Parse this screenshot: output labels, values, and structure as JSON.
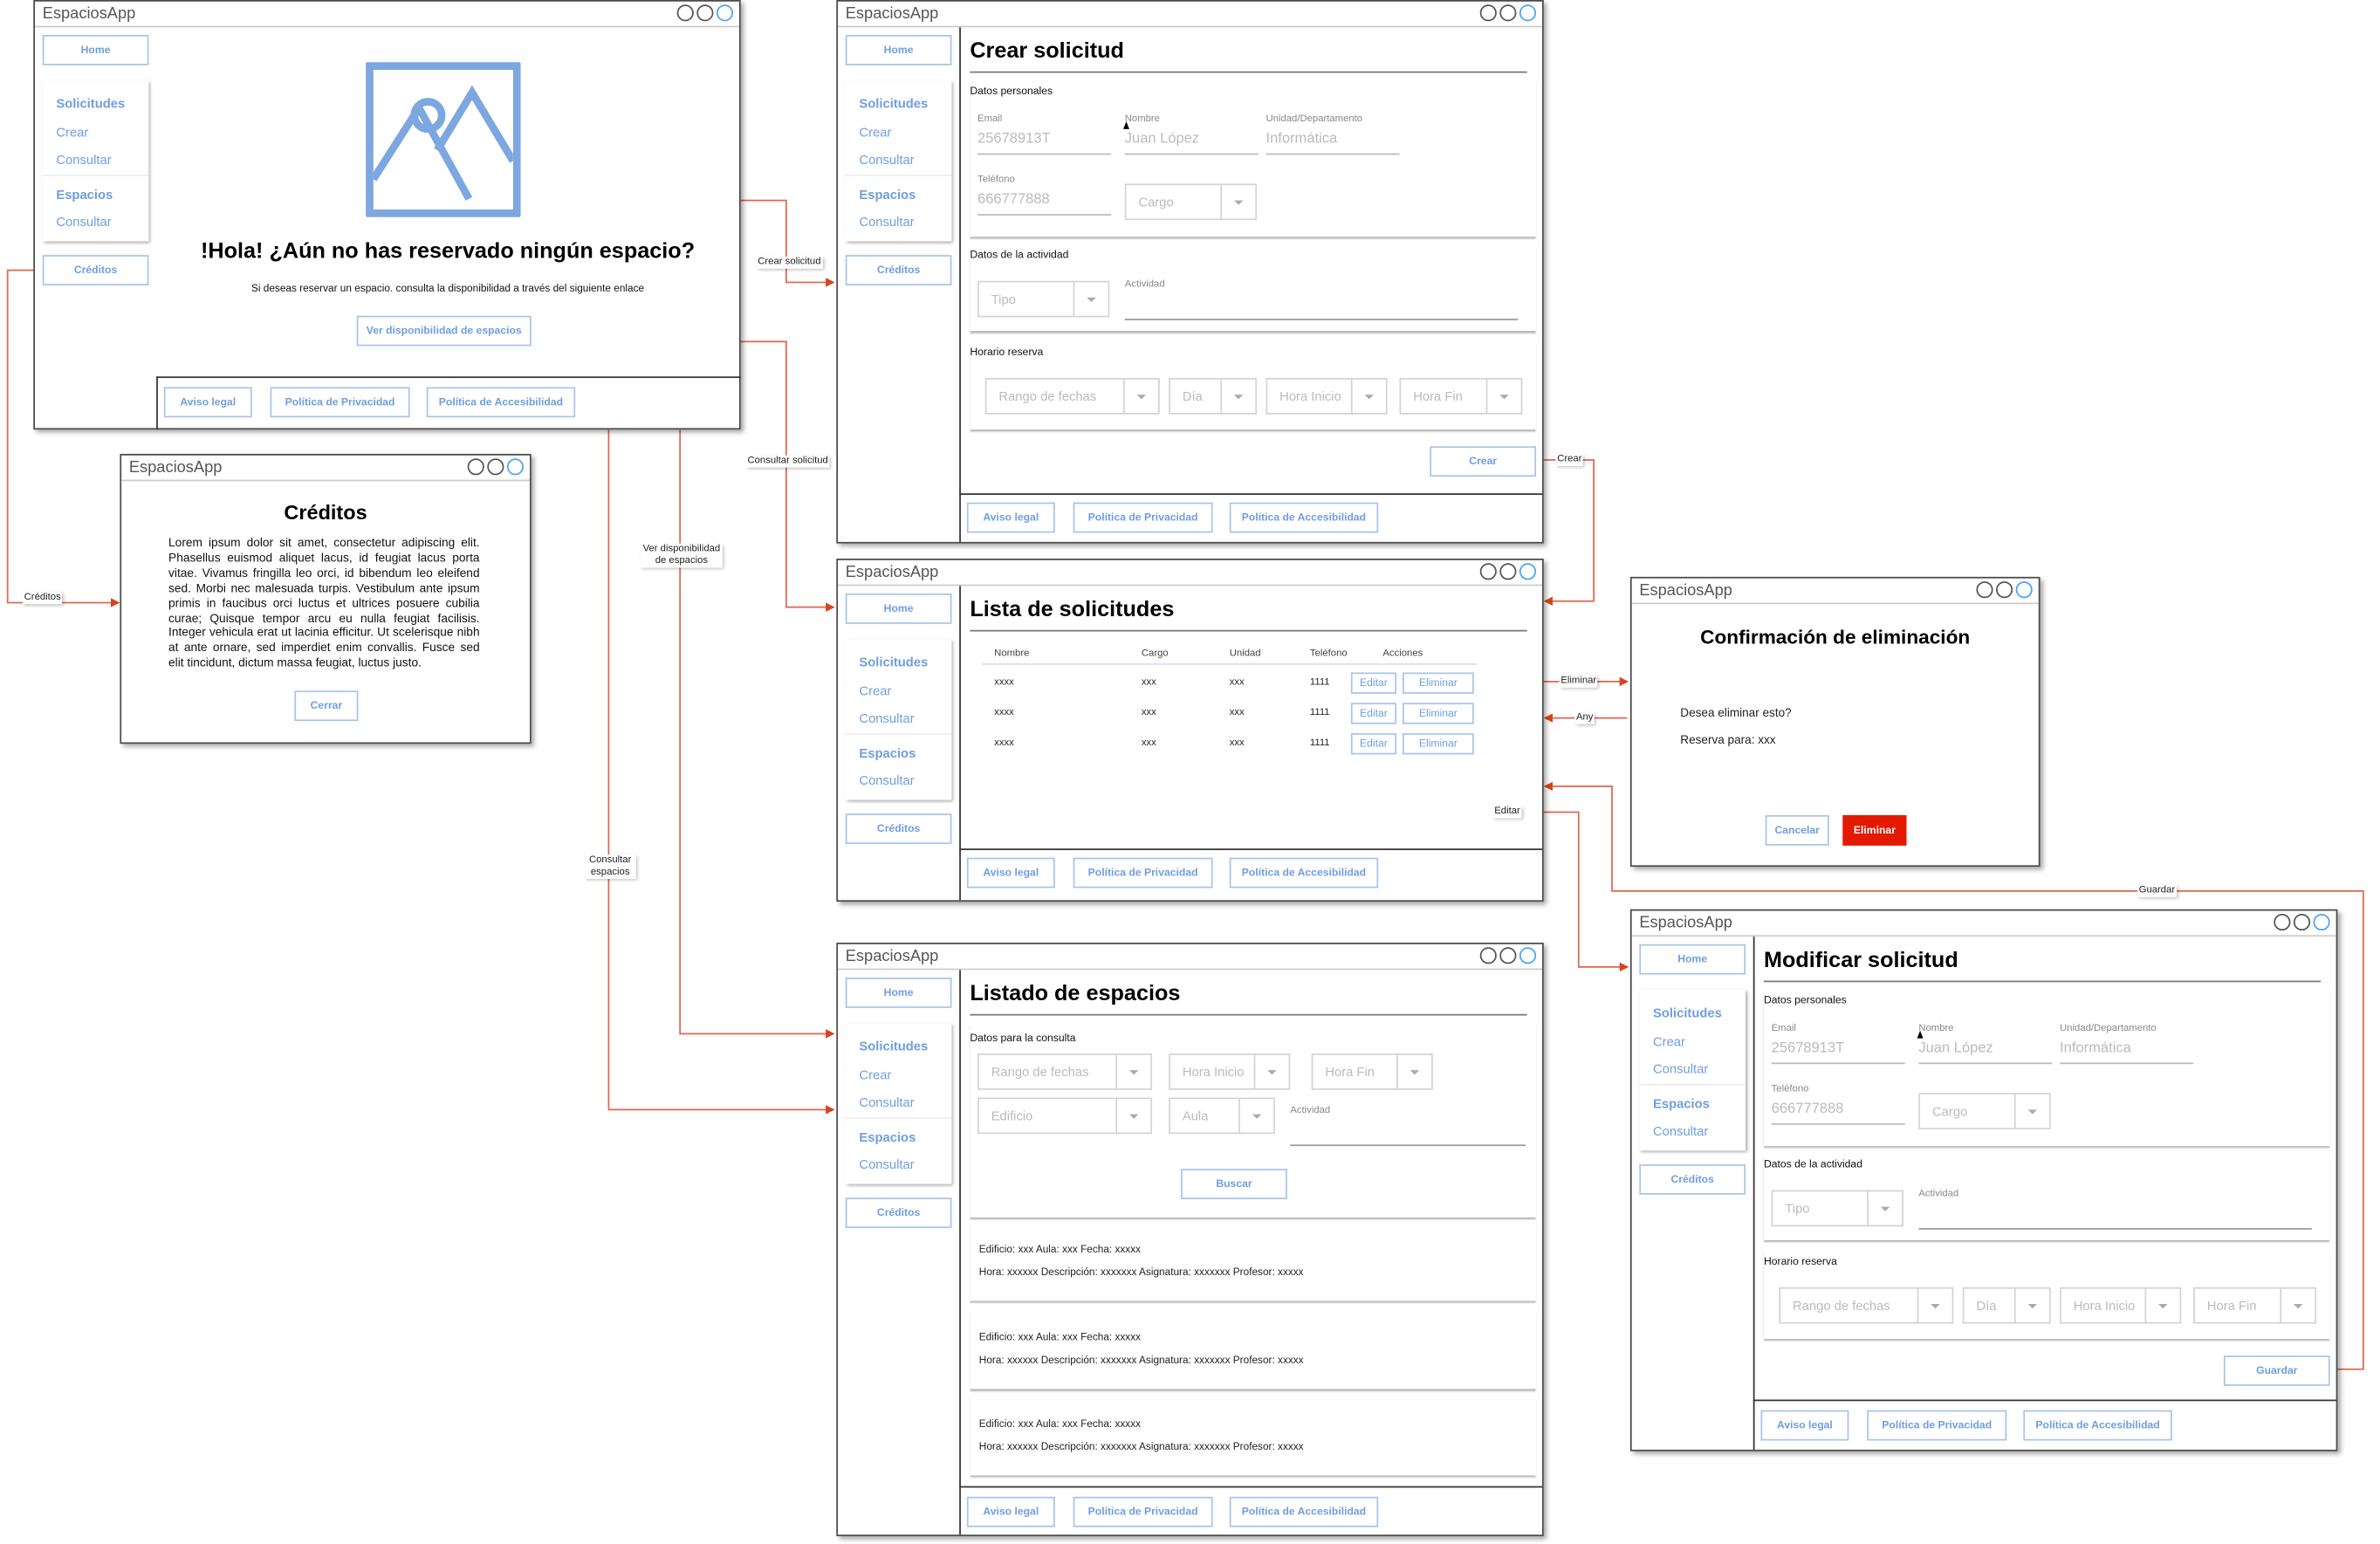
{
  "app_title": "EspaciosApp",
  "sidebar": {
    "home": "Home",
    "solicitudes": "Solicitudes",
    "crear": "Crear",
    "consultar_solicitudes": "Consultar",
    "espacios": "Espacios",
    "consultar_espacios": "Consultar",
    "creditos": "Créditos"
  },
  "footer": {
    "aviso": "Aviso legal",
    "privacidad": "Política de Privacidad",
    "accesibilidad": "Política de Accesibilidad"
  },
  "home": {
    "image_icon": "image-placeholder-icon",
    "heading": "!Hola! ¿Aún no has reservado ningún espacio?",
    "subtitle": "Si deseas reservar un espacio. consulta la disponibilidad a través del siguiente enlace",
    "button": "Ver disponibilidad de espacios"
  },
  "creditos": {
    "heading": "Créditos",
    "body": "Lorem ipsum dolor sit amet, consectetur adipiscing elit. Phasellus euismod aliquet lacus, id feugiat lacus porta vitae. Vivamus fringilla leo orci, id bibendum leo eleifend sed. Morbi nec malesuada turpis. Vestibulum ante ipsum primis in faucibus orci luctus et ultrices posuere cubilia curae; Quisque tempor arcu eu nulla feugiat facilisis. Integer vehicula erat ut lacinia efficitur. Ut scelerisque nibh at ante ornare, sed imperdiet enim convallis. Fusce sed elit tincidunt, dictum massa feugiat, luctus justo.",
    "close": "Cerrar"
  },
  "form": {
    "personal_section": "Datos personales",
    "email_label": "Email",
    "email_value": "25678913T",
    "nombre_label": "Nombre",
    "nombre_value": "Juan López",
    "unidad_label": "Unidad/Departamento",
    "unidad_value": "Informática",
    "telefono_label": "Teléfono",
    "telefono_value": "666777888",
    "cargo": "Cargo",
    "activity_section": "Datos de la actividad",
    "tipo": "Tipo",
    "actividad_label": "Actividad",
    "schedule_section": "Horario reserva",
    "rango": "Rango de fechas",
    "dia": "Día",
    "hora_inicio": "Hora Inicio",
    "hora_fin": "Hora Fin"
  },
  "crear": {
    "title": "Crear solicitud",
    "submit": "Crear"
  },
  "modificar": {
    "title": "Modificar solicitud",
    "submit": "Guardar"
  },
  "lista": {
    "title": "Lista de solicitudes",
    "columns": [
      "Nombre",
      "Cargo",
      "Unidad",
      "Teléfono",
      "Acciones"
    ],
    "rows": [
      [
        "xxxx",
        "xxx",
        "xxx",
        "1111"
      ],
      [
        "xxxx",
        "xxx",
        "xxx",
        "1111"
      ],
      [
        "xxxx",
        "xxx",
        "xxx",
        "1111"
      ]
    ],
    "edit": "Editar",
    "delete": "Eliminar"
  },
  "espacios": {
    "title": "Listado de espacios",
    "section": "Datos para la consulta",
    "rango": "Rango de fechas",
    "hora_inicio": "Hora Inicio",
    "hora_fin": "Hora Fin",
    "edificio": "Edificio",
    "aula": "Aula",
    "actividad_label": "Actividad",
    "search": "Buscar",
    "results": [
      {
        "line1": "Edificio: xxx Aula: xxx Fecha: xxxxx",
        "line2": "Hora: xxxxxx Descripción: xxxxxxx Asignatura: xxxxxxx Profesor: xxxxx"
      },
      {
        "line1": "Edificio: xxx Aula: xxx Fecha: xxxxx",
        "line2": "Hora: xxxxxx Descripción: xxxxxxx Asignatura: xxxxxxx Profesor: xxxxx"
      },
      {
        "line1": "Edificio: xxx Aula: xxx Fecha: xxxxx",
        "line2": "Hora: xxxxxx Descripción: xxxxxxx Asignatura: xxxxxxx Profesor: xxxxx"
      }
    ]
  },
  "confirm": {
    "heading": "Confirmación de eliminación",
    "question": "Desea eliminar esto?",
    "detail": "Reserva para: xxx",
    "cancel": "Cancelar",
    "delete": "Eliminar"
  },
  "edges": {
    "crear_solicitud": "Crear solicitud",
    "consultar_solicitud": "Consultar solicitud",
    "ver_disponibilidad": "Ver disponibilidad de espacios",
    "consultar_espacios": "Consultar espacios",
    "creditos": "Créditos",
    "crear": "Crear",
    "eliminar": "Eliminar",
    "any": "Any",
    "editar": "Editar",
    "guardar": "Guardar"
  },
  "colors": {
    "accent": "#6f9ee0",
    "connector": "#e0664f",
    "danger": "#e31a00"
  }
}
